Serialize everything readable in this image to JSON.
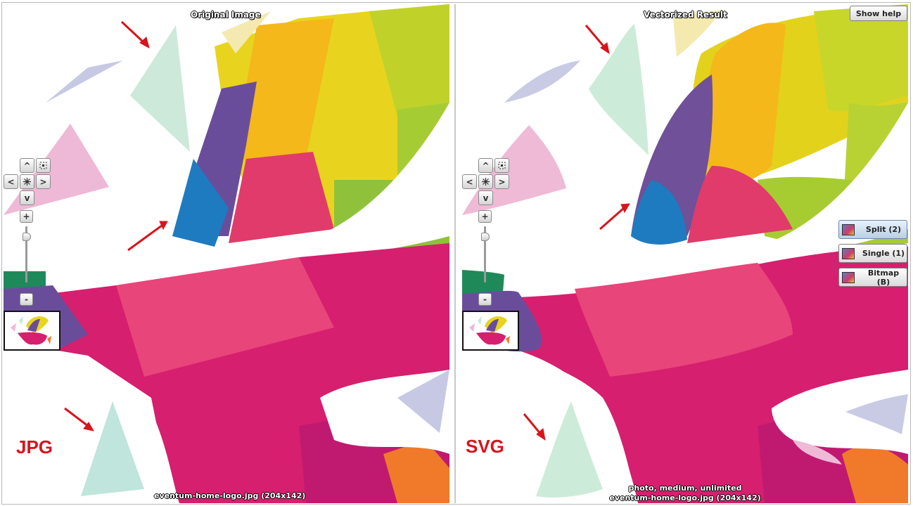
{
  "left_pane": {
    "title": "Original Image",
    "caption": "eventum-home-logo.jpg  (204x142)",
    "format_label": "JPG"
  },
  "right_pane": {
    "title": "Vectorized Result",
    "caption_line1": "photo, medium, unlimited",
    "caption_line2": "eventum-home-logo.jpg  (204x142)",
    "format_label": "SVG"
  },
  "nav": {
    "up": "^",
    "down": "v",
    "left": "<",
    "right": ">",
    "zoom_in": "+",
    "zoom_out": "-"
  },
  "help_button": "Show help",
  "view_modes": [
    {
      "label": "Split (2)",
      "active": true
    },
    {
      "label": "Single (1)",
      "active": false
    },
    {
      "label": "Bitmap (B)",
      "active": false
    }
  ],
  "colors": {
    "arrow": "#d8141c",
    "pink": "#d61f6e",
    "yellow": "#f4c21a",
    "lime": "#c8d62a",
    "purple": "#6b4e9e",
    "blue": "#1e7fc0"
  }
}
